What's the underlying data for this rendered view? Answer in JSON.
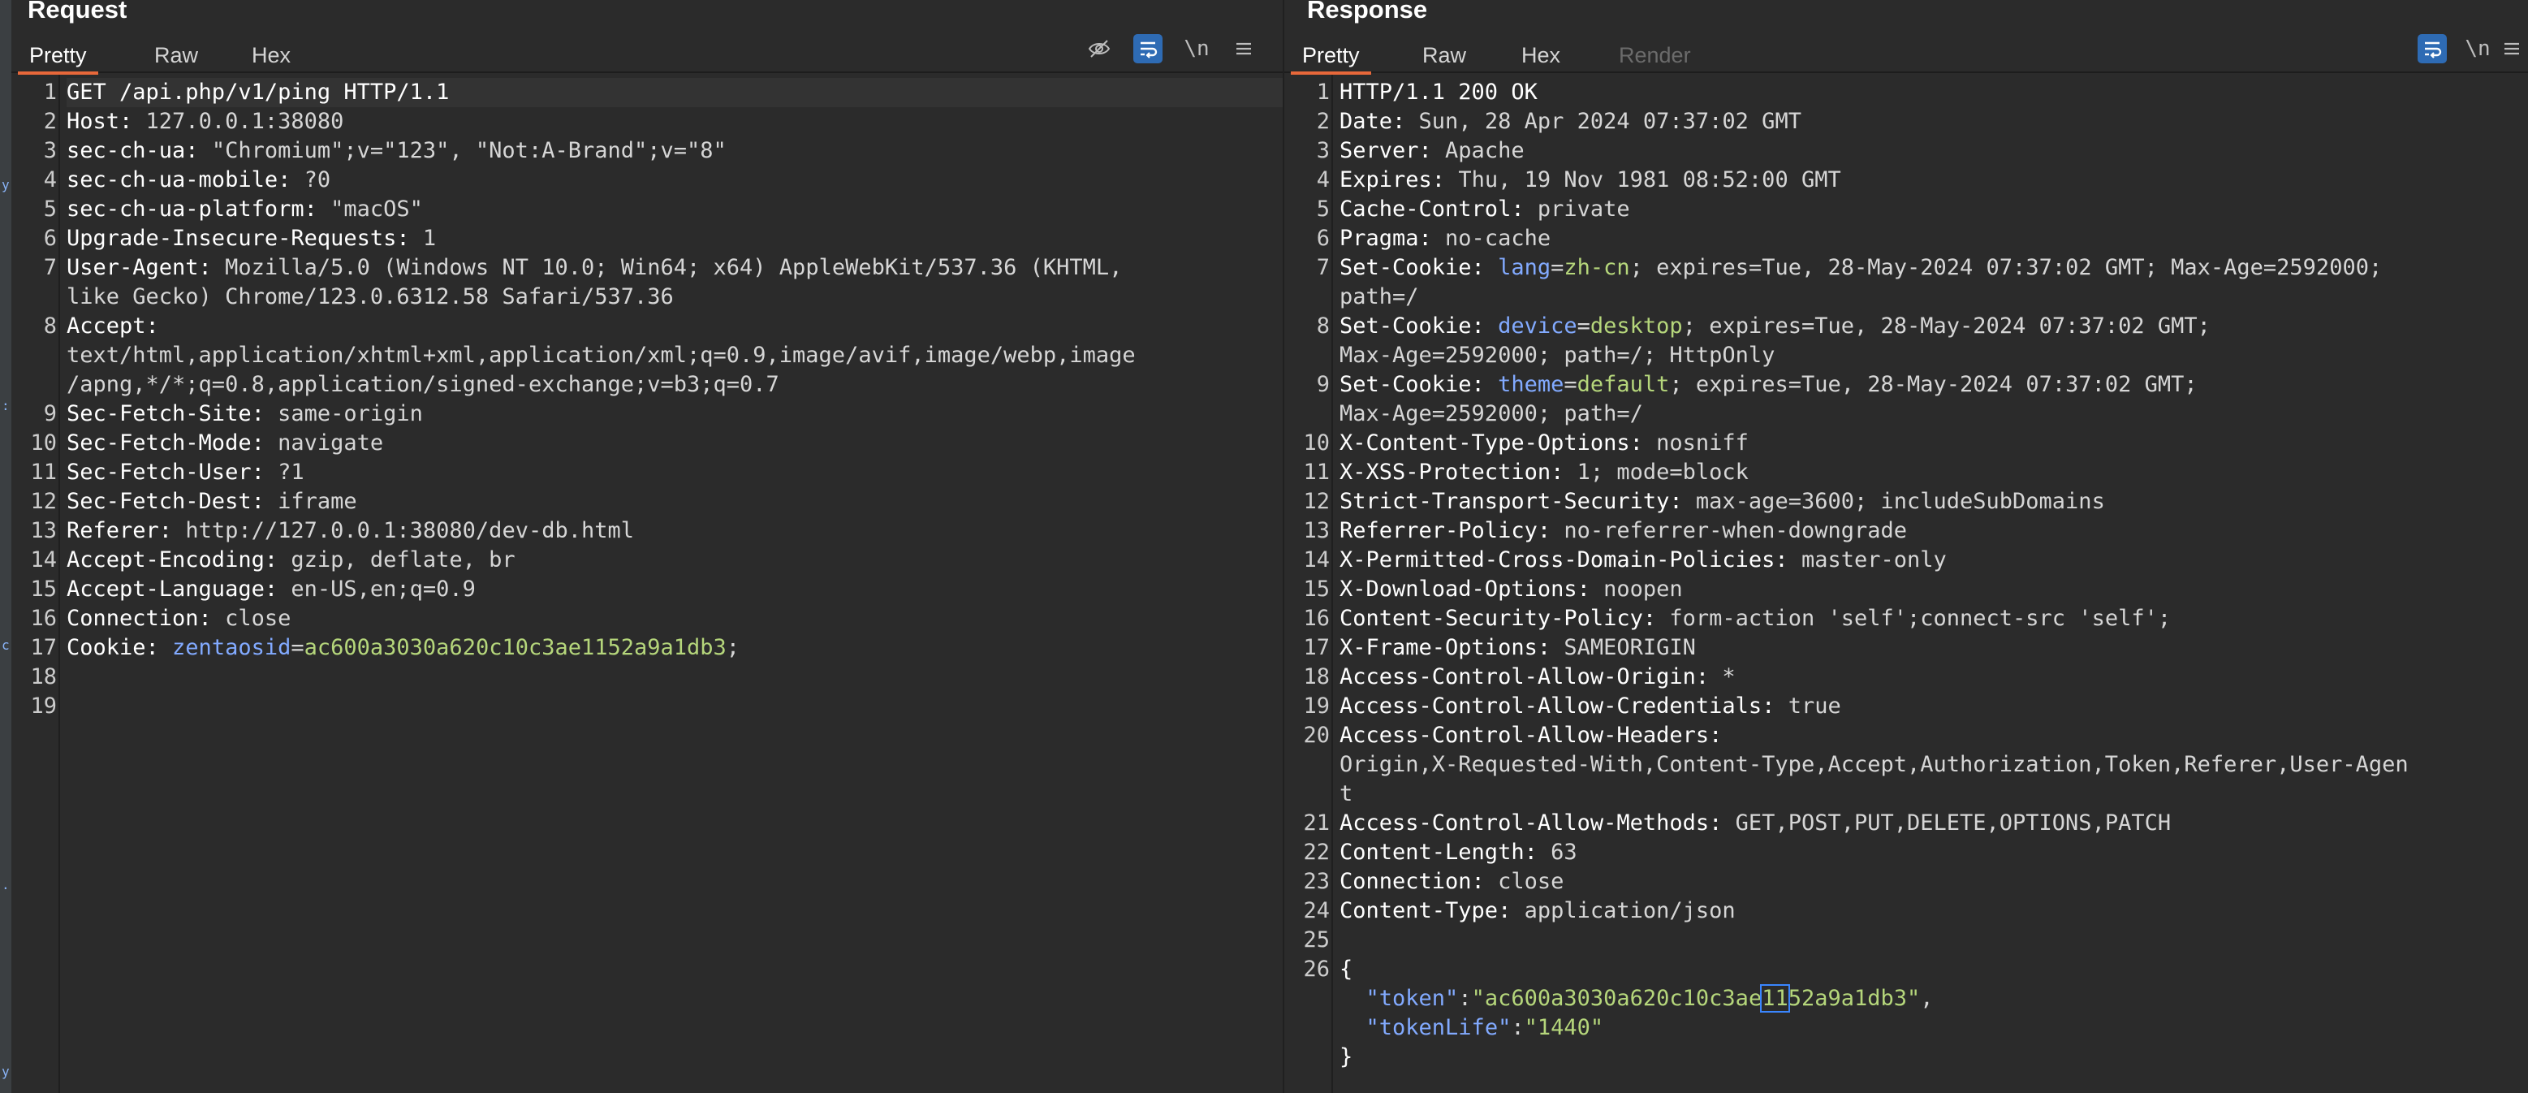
{
  "request": {
    "title": "Request",
    "tabs": [
      "Pretty",
      "Raw",
      "Hex"
    ],
    "active_tab": "Pretty",
    "toolbar": {
      "newline_label": "\\n"
    },
    "lines": [
      {
        "n": "1",
        "parts": [
          {
            "t": "GET /api.php/v1/ping HTTP/1.1",
            "c": "k"
          }
        ]
      },
      {
        "n": "2",
        "parts": [
          {
            "t": "Host: ",
            "c": "k"
          },
          {
            "t": "127.0.0.1:38080",
            "c": "v"
          }
        ]
      },
      {
        "n": "3",
        "parts": [
          {
            "t": "sec-ch-ua: ",
            "c": "k"
          },
          {
            "t": "\"Chromium\";v=\"123\", \"Not:A-Brand\";v=\"8\"",
            "c": "v"
          }
        ]
      },
      {
        "n": "4",
        "parts": [
          {
            "t": "sec-ch-ua-mobile: ",
            "c": "k"
          },
          {
            "t": "?0",
            "c": "v"
          }
        ]
      },
      {
        "n": "5",
        "parts": [
          {
            "t": "sec-ch-ua-platform: ",
            "c": "k"
          },
          {
            "t": "\"macOS\"",
            "c": "v"
          }
        ]
      },
      {
        "n": "6",
        "parts": [
          {
            "t": "Upgrade-Insecure-Requests: ",
            "c": "k"
          },
          {
            "t": "1",
            "c": "v"
          }
        ]
      },
      {
        "n": "7",
        "parts": [
          {
            "t": "User-Agent: ",
            "c": "k"
          },
          {
            "t": "Mozilla/5.0 (Windows NT 10.0; Win64; x64) AppleWebKit/537.36 (KHTML,",
            "c": "v"
          }
        ]
      },
      {
        "n": "",
        "parts": [
          {
            "t": "like Gecko) Chrome/123.0.6312.58 Safari/537.36",
            "c": "v"
          }
        ]
      },
      {
        "n": "8",
        "parts": [
          {
            "t": "Accept:",
            "c": "k"
          }
        ]
      },
      {
        "n": "",
        "parts": [
          {
            "t": "text/html,application/xhtml+xml,application/xml;q=0.9,image/avif,image/webp,image",
            "c": "v"
          }
        ]
      },
      {
        "n": "",
        "parts": [
          {
            "t": "/apng,*/*;q=0.8,application/signed-exchange;v=b3;q=0.7",
            "c": "v"
          }
        ]
      },
      {
        "n": "9",
        "parts": [
          {
            "t": "Sec-Fetch-Site: ",
            "c": "k"
          },
          {
            "t": "same-origin",
            "c": "v"
          }
        ]
      },
      {
        "n": "10",
        "parts": [
          {
            "t": "Sec-Fetch-Mode: ",
            "c": "k"
          },
          {
            "t": "navigate",
            "c": "v"
          }
        ]
      },
      {
        "n": "11",
        "parts": [
          {
            "t": "Sec-Fetch-User: ",
            "c": "k"
          },
          {
            "t": "?1",
            "c": "v"
          }
        ]
      },
      {
        "n": "12",
        "parts": [
          {
            "t": "Sec-Fetch-Dest: ",
            "c": "k"
          },
          {
            "t": "iframe",
            "c": "v"
          }
        ]
      },
      {
        "n": "13",
        "parts": [
          {
            "t": "Referer: ",
            "c": "k"
          },
          {
            "t": "http://127.0.0.1:38080/dev-db.html",
            "c": "v"
          }
        ]
      },
      {
        "n": "14",
        "parts": [
          {
            "t": "Accept-Encoding: ",
            "c": "k"
          },
          {
            "t": "gzip, deflate, br",
            "c": "v"
          }
        ]
      },
      {
        "n": "15",
        "parts": [
          {
            "t": "Accept-Language: ",
            "c": "k"
          },
          {
            "t": "en-US,en;q=0.9",
            "c": "v"
          }
        ]
      },
      {
        "n": "16",
        "parts": [
          {
            "t": "Connection: ",
            "c": "k"
          },
          {
            "t": "close",
            "c": "v"
          }
        ]
      },
      {
        "n": "17",
        "parts": [
          {
            "t": "Cookie: ",
            "c": "k"
          },
          {
            "t": "zentaosid",
            "c": "ck"
          },
          {
            "t": "=",
            "c": "v"
          },
          {
            "t": "ac600a3030a620c10c3ae1152a9a1db3",
            "c": "cv"
          },
          {
            "t": ";",
            "c": "v"
          }
        ]
      },
      {
        "n": "18",
        "parts": []
      },
      {
        "n": "19",
        "parts": []
      }
    ]
  },
  "response": {
    "title": "Response",
    "tabs": [
      "Pretty",
      "Raw",
      "Hex",
      "Render"
    ],
    "active_tab": "Pretty",
    "toolbar": {
      "newline_label": "\\n"
    },
    "lines": [
      {
        "n": "1",
        "parts": [
          {
            "t": "HTTP/1.1 200 OK",
            "c": "k"
          }
        ]
      },
      {
        "n": "2",
        "parts": [
          {
            "t": "Date: ",
            "c": "k"
          },
          {
            "t": "Sun, 28 Apr 2024 07:37:02 GMT",
            "c": "v"
          }
        ]
      },
      {
        "n": "3",
        "parts": [
          {
            "t": "Server: ",
            "c": "k"
          },
          {
            "t": "Apache",
            "c": "v"
          }
        ]
      },
      {
        "n": "4",
        "parts": [
          {
            "t": "Expires: ",
            "c": "k"
          },
          {
            "t": "Thu, 19 Nov 1981 08:52:00 GMT",
            "c": "v"
          }
        ]
      },
      {
        "n": "5",
        "parts": [
          {
            "t": "Cache-Control: ",
            "c": "k"
          },
          {
            "t": "private",
            "c": "v"
          }
        ]
      },
      {
        "n": "6",
        "parts": [
          {
            "t": "Pragma: ",
            "c": "k"
          },
          {
            "t": "no-cache",
            "c": "v"
          }
        ]
      },
      {
        "n": "7",
        "parts": [
          {
            "t": "Set-Cookie: ",
            "c": "k"
          },
          {
            "t": "lang",
            "c": "ck"
          },
          {
            "t": "=",
            "c": "v"
          },
          {
            "t": "zh-cn",
            "c": "cv"
          },
          {
            "t": "; expires=Tue, 28-May-2024 07:37:02 GMT; Max-Age=2592000;",
            "c": "v"
          }
        ]
      },
      {
        "n": "",
        "parts": [
          {
            "t": "path=/",
            "c": "v"
          }
        ]
      },
      {
        "n": "8",
        "parts": [
          {
            "t": "Set-Cookie: ",
            "c": "k"
          },
          {
            "t": "device",
            "c": "ck"
          },
          {
            "t": "=",
            "c": "v"
          },
          {
            "t": "desktop",
            "c": "cv"
          },
          {
            "t": "; expires=Tue, 28-May-2024 07:37:02 GMT;",
            "c": "v"
          }
        ]
      },
      {
        "n": "",
        "parts": [
          {
            "t": "Max-Age=2592000; path=/; HttpOnly",
            "c": "v"
          }
        ]
      },
      {
        "n": "9",
        "parts": [
          {
            "t": "Set-Cookie: ",
            "c": "k"
          },
          {
            "t": "theme",
            "c": "ck"
          },
          {
            "t": "=",
            "c": "v"
          },
          {
            "t": "default",
            "c": "cv"
          },
          {
            "t": "; expires=Tue, 28-May-2024 07:37:02 GMT;",
            "c": "v"
          }
        ]
      },
      {
        "n": "",
        "parts": [
          {
            "t": "Max-Age=2592000; path=/",
            "c": "v"
          }
        ]
      },
      {
        "n": "10",
        "parts": [
          {
            "t": "X-Content-Type-Options: ",
            "c": "k"
          },
          {
            "t": "nosniff",
            "c": "v"
          }
        ]
      },
      {
        "n": "11",
        "parts": [
          {
            "t": "X-XSS-Protection: ",
            "c": "k"
          },
          {
            "t": "1; mode=block",
            "c": "v"
          }
        ]
      },
      {
        "n": "12",
        "parts": [
          {
            "t": "Strict-Transport-Security: ",
            "c": "k"
          },
          {
            "t": "max-age=3600; includeSubDomains",
            "c": "v"
          }
        ]
      },
      {
        "n": "13",
        "parts": [
          {
            "t": "Referrer-Policy: ",
            "c": "k"
          },
          {
            "t": "no-referrer-when-downgrade",
            "c": "v"
          }
        ]
      },
      {
        "n": "14",
        "parts": [
          {
            "t": "X-Permitted-Cross-Domain-Policies: ",
            "c": "k"
          },
          {
            "t": "master-only",
            "c": "v"
          }
        ]
      },
      {
        "n": "15",
        "parts": [
          {
            "t": "X-Download-Options: ",
            "c": "k"
          },
          {
            "t": "noopen",
            "c": "v"
          }
        ]
      },
      {
        "n": "16",
        "parts": [
          {
            "t": "Content-Security-Policy: ",
            "c": "k"
          },
          {
            "t": "form-action 'self';connect-src 'self';",
            "c": "v"
          }
        ]
      },
      {
        "n": "17",
        "parts": [
          {
            "t": "X-Frame-Options: ",
            "c": "k"
          },
          {
            "t": "SAMEORIGIN",
            "c": "v"
          }
        ]
      },
      {
        "n": "18",
        "parts": [
          {
            "t": "Access-Control-Allow-Origin: ",
            "c": "k"
          },
          {
            "t": "*",
            "c": "v"
          }
        ]
      },
      {
        "n": "19",
        "parts": [
          {
            "t": "Access-Control-Allow-Credentials: ",
            "c": "k"
          },
          {
            "t": "true",
            "c": "v"
          }
        ]
      },
      {
        "n": "20",
        "parts": [
          {
            "t": "Access-Control-Allow-Headers:",
            "c": "k"
          }
        ]
      },
      {
        "n": "",
        "parts": [
          {
            "t": "Origin,X-Requested-With,Content-Type,Accept,Authorization,Token,Referer,User-Agen",
            "c": "v"
          }
        ]
      },
      {
        "n": "",
        "parts": [
          {
            "t": "t",
            "c": "v"
          }
        ]
      },
      {
        "n": "21",
        "parts": [
          {
            "t": "Access-Control-Allow-Methods: ",
            "c": "k"
          },
          {
            "t": "GET,POST,PUT,DELETE,OPTIONS,PATCH",
            "c": "v"
          }
        ]
      },
      {
        "n": "22",
        "parts": [
          {
            "t": "Content-Length: ",
            "c": "k"
          },
          {
            "t": "63",
            "c": "v"
          }
        ]
      },
      {
        "n": "23",
        "parts": [
          {
            "t": "Connection: ",
            "c": "k"
          },
          {
            "t": "close",
            "c": "v"
          }
        ]
      },
      {
        "n": "24",
        "parts": [
          {
            "t": "Content-Type: ",
            "c": "k"
          },
          {
            "t": "application/json",
            "c": "v"
          }
        ]
      },
      {
        "n": "25",
        "parts": []
      },
      {
        "n": "26",
        "parts": [
          {
            "t": "{",
            "c": "k"
          }
        ]
      },
      {
        "n": "",
        "parts": [
          {
            "t": "  ",
            "c": "v"
          },
          {
            "t": "\"token\"",
            "c": "jk"
          },
          {
            "t": ":",
            "c": "v"
          },
          {
            "t": "\"ac600a3030a620c10c3ae",
            "c": "js"
          },
          {
            "t": "11",
            "c": "js cursor-box"
          },
          {
            "t": "52a9a1db3\"",
            "c": "js"
          },
          {
            "t": ",",
            "c": "v"
          }
        ]
      },
      {
        "n": "",
        "parts": [
          {
            "t": "  ",
            "c": "v"
          },
          {
            "t": "\"tokenLife\"",
            "c": "jk"
          },
          {
            "t": ":",
            "c": "v"
          },
          {
            "t": "\"1440\"",
            "c": "js"
          }
        ]
      },
      {
        "n": "",
        "parts": [
          {
            "t": "}",
            "c": "k"
          }
        ]
      }
    ]
  }
}
